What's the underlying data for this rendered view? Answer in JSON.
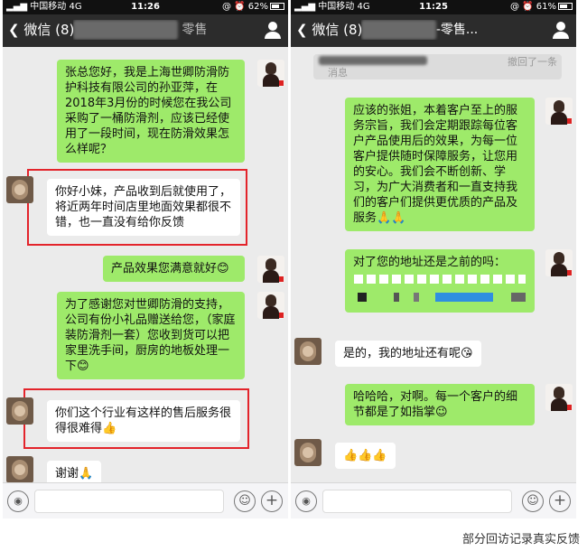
{
  "left": {
    "status": {
      "carrier": "中国移动",
      "network": "4G",
      "time": "11:26",
      "battery": "62%"
    },
    "nav": {
      "back_label": "微信 (8)",
      "title": "零售"
    },
    "messages": {
      "m1": "张总您好，我是上海世卿防滑防护科技有限公司的孙亚萍，在2018年3月份的时候您在我公司采购了一桶防滑剂，应该已经使用了一段时间，现在防滑效果怎么样呢？",
      "m2": "你好小妹，产品收到后就使用了，将近两年时间店里地面效果都很不错，也一直没有给你反馈",
      "m3": "产品效果您满意就好😊",
      "m4": "为了感谢您对世卿防滑的支持，公司有份小礼品赠送给您，（家庭装防滑剂一套）您收到货可以把家里洗手间，厨房的地板处理一下😊",
      "m5": "你们这个行业有这样的售后服务很得很难得👍",
      "m6": "谢谢🙏"
    }
  },
  "right": {
    "status": {
      "carrier": "中国移动",
      "network": "4G",
      "time": "11:25",
      "battery": "61%"
    },
    "nav": {
      "back_label": "微信 (8)",
      "title": "-零售..."
    },
    "recall": {
      "prefix": "消息",
      "text": "撤回了一条"
    },
    "messages": {
      "m1": "应该的张姐，本着客户至上的服务宗旨，我们会定期跟踪每位客户产品使用后的效果，为每一位客户提供随时保障服务，让您用的安心。我们会不断创新、学习，为广大消费者和一直支持我们的客户们提供更优质的产品及服务🙏🙏",
      "m2": "对了您的地址还是之前的吗：",
      "m3": "是的，我的地址还有呢😘",
      "m4": "哈哈哈，对啊。每一个客户的细节都是了如指掌😉",
      "m5": "👍👍👍"
    }
  },
  "caption": "部分回访记录真实反馈",
  "colors": {
    "outgoing_bubble": "#9eea6a",
    "incoming_bubble": "#ffffff",
    "highlight": "#e3242b",
    "navbar": "#2c2c2c"
  },
  "icons": [
    "signal-icon",
    "battery-icon",
    "back-chevron-icon",
    "person-icon",
    "voice-icon",
    "emoji-icon",
    "plus-icon"
  ]
}
